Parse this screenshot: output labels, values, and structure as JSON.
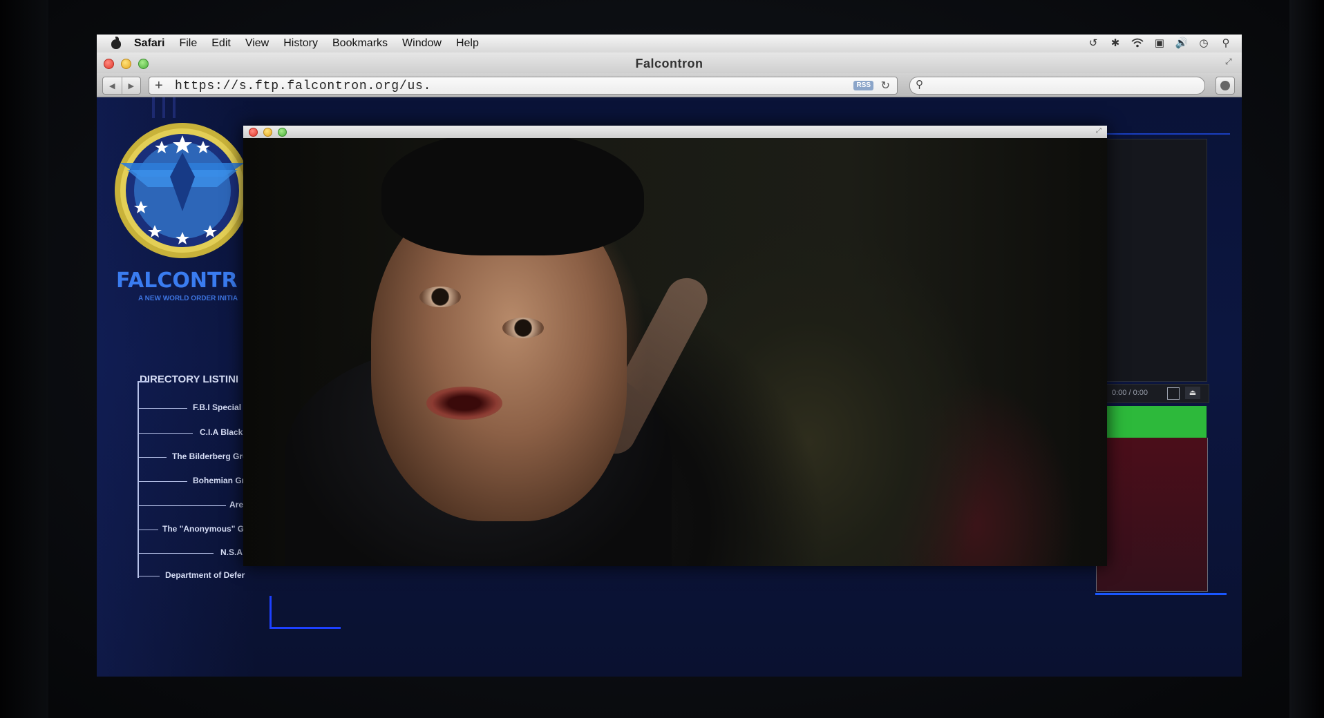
{
  "menubar": {
    "app": "Safari",
    "items": [
      "File",
      "Edit",
      "View",
      "History",
      "Bookmarks",
      "Window",
      "Help"
    ],
    "status_icons": [
      "time-machine-icon",
      "bluetooth-icon",
      "wifi-icon",
      "display-icon",
      "volume-icon",
      "clock-icon",
      "spotlight-icon"
    ]
  },
  "window": {
    "title": "Falcontron"
  },
  "toolbar": {
    "url": "https://s.ftp.falcontron.org/us.",
    "rss_label": "RSS",
    "search_placeholder": ""
  },
  "site": {
    "brand": "FALCONTR",
    "tagline": "A NEW WORLD ORDER INITIA",
    "directory": {
      "heading": "DIRECTORY LISTINI",
      "items": [
        "F.B.I Special C",
        "C.I.A Black C",
        "The Bilderberg Gro",
        "Bohemian Gro",
        "Area",
        "The \"Anonymous\" Gro",
        "N.S.A Fi",
        "Department of Defer"
      ]
    },
    "player": {
      "time": "0:00 / 0:00"
    }
  },
  "colors": {
    "page_bg": "#0c1640",
    "brand_blue": "#3a7cf0",
    "accent_green": "#2db93b",
    "accent_red": "#4b0e1a"
  }
}
